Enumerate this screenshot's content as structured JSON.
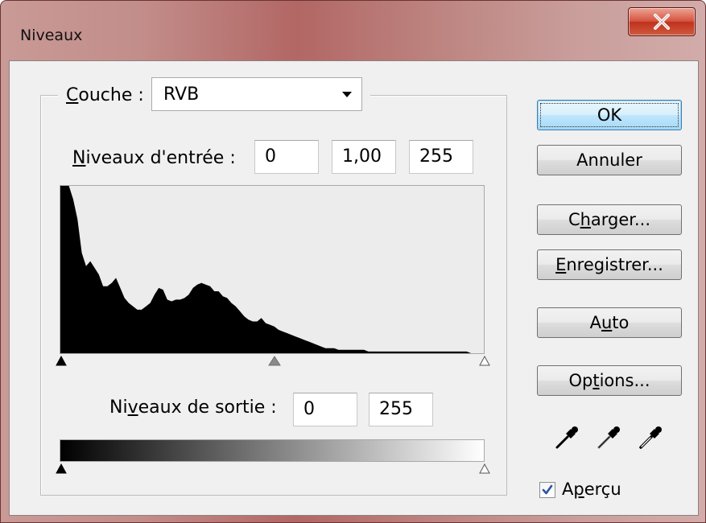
{
  "window": {
    "title": "Niveaux",
    "close_symbol": "X"
  },
  "channel": {
    "label_prefix": "",
    "label_mnemonic": "C",
    "label_rest": "ouche :",
    "value": "RVB"
  },
  "input_levels": {
    "label_mnemonic": "N",
    "label_rest": "iveaux d'entrée :",
    "black": "0",
    "gamma": "1,00",
    "white": "255"
  },
  "output_levels": {
    "label_prefix": "Ni",
    "label_mnemonic": "v",
    "label_rest": "eaux de sortie :",
    "black": "0",
    "white": "255"
  },
  "buttons": {
    "ok": "OK",
    "cancel": "Annuler",
    "load": {
      "prefix": "C",
      "mnemonic": "h",
      "rest": "arger..."
    },
    "save": {
      "prefix": "",
      "mnemonic": "E",
      "rest": "nregistrer..."
    },
    "auto": {
      "prefix": "A",
      "mnemonic": "u",
      "rest": "to"
    },
    "options": {
      "prefix": "Op",
      "mnemonic": "t",
      "rest": "ions..."
    }
  },
  "preview": {
    "checked": true,
    "prefix": "A",
    "mnemonic": "p",
    "rest": "erçu"
  },
  "icons": {
    "eyedroppers": [
      "black-eyedropper-icon",
      "gray-eyedropper-icon",
      "white-eyedropper-icon"
    ],
    "channel_dropdown": "chevron-down-icon",
    "close": "close-icon"
  },
  "histogram": {
    "bins": [
      100,
      100,
      100,
      92,
      80,
      60,
      52,
      55,
      51,
      47,
      40,
      40,
      42,
      45,
      39,
      33,
      30,
      28,
      26,
      26,
      28,
      30,
      35,
      39,
      38,
      32,
      31,
      32,
      32,
      33,
      35,
      39,
      41,
      42,
      41,
      40,
      37,
      37,
      34,
      33,
      30,
      28,
      25,
      22,
      20,
      19,
      19,
      21,
      18,
      17,
      16,
      14,
      13,
      12,
      11,
      10,
      9,
      8,
      7,
      6,
      5,
      4,
      3,
      3,
      3,
      2,
      2,
      2,
      2,
      2,
      2,
      2,
      1,
      1,
      1,
      1,
      1,
      1,
      1,
      1,
      1,
      1,
      1,
      1,
      1,
      1,
      1,
      1,
      1,
      1,
      1,
      1,
      1,
      1,
      1,
      1,
      0,
      0,
      0,
      0
    ]
  },
  "colors": {
    "accent": "#3c7fb1",
    "title_gradient_mid": "#b26764"
  }
}
